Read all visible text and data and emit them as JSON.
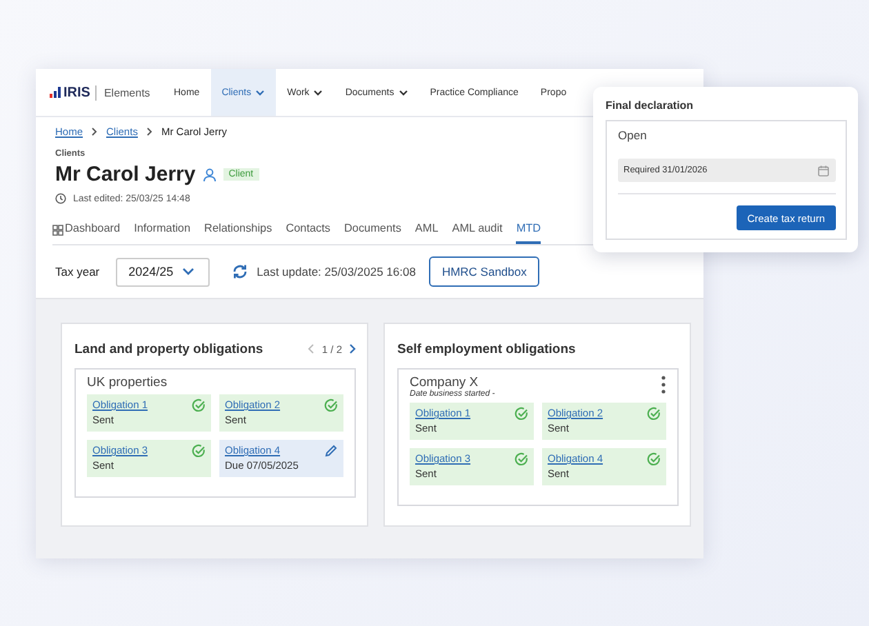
{
  "nav": {
    "logo": "IRIS",
    "product": "Elements",
    "items": [
      {
        "label": "Home",
        "selected": false,
        "dropdown": false
      },
      {
        "label": "Clients",
        "selected": true,
        "dropdown": true
      },
      {
        "label": "Work",
        "selected": false,
        "dropdown": true
      },
      {
        "label": "Documents",
        "selected": false,
        "dropdown": true
      },
      {
        "label": "Practice Compliance",
        "selected": false,
        "dropdown": false
      },
      {
        "label": "Propo",
        "selected": false,
        "dropdown": false
      }
    ]
  },
  "breadcrumb": [
    {
      "label": "Home",
      "link": true
    },
    {
      "label": "Clients",
      "link": true
    },
    {
      "label": "Mr Carol Jerry",
      "link": false
    }
  ],
  "client": {
    "section": "Clients",
    "name": "Mr Carol Jerry",
    "badge": "Client",
    "last_edited": "Last edited: 25/03/25 14:48"
  },
  "tabs": [
    {
      "label": "Dashboard",
      "selected": false
    },
    {
      "label": "Information",
      "selected": false
    },
    {
      "label": "Relationships",
      "selected": false
    },
    {
      "label": "Contacts",
      "selected": false
    },
    {
      "label": "Documents",
      "selected": false
    },
    {
      "label": "AML",
      "selected": false
    },
    {
      "label": "AML audit",
      "selected": false
    },
    {
      "label": "MTD",
      "selected": true
    }
  ],
  "toolbar": {
    "tax_year_label": "Tax year",
    "tax_year": "2024/25",
    "last_update": "Last update: 25/03/2025 16:08",
    "sandbox_button": "HMRC Sandbox"
  },
  "panels": [
    {
      "title": "Land and property obligations",
      "pager": "1 / 2",
      "group": {
        "name": "UK properties",
        "obligations": [
          {
            "label": "Obligation 1",
            "status": "Sent",
            "kind": "sent"
          },
          {
            "label": "Obligation 2",
            "status": "Sent",
            "kind": "sent"
          },
          {
            "label": "Obligation 3",
            "status": "Sent",
            "kind": "sent"
          },
          {
            "label": "Obligation 4",
            "status": "Due 07/05/2025",
            "kind": "due"
          }
        ]
      }
    },
    {
      "title": "Self employment obligations",
      "group": {
        "name": "Company X",
        "subtitle": "Date business started -",
        "menu": true,
        "obligations": [
          {
            "label": "Obligation 1",
            "status": "Sent",
            "kind": "sent"
          },
          {
            "label": "Obligation 2",
            "status": "Sent",
            "kind": "sent"
          },
          {
            "label": "Obligation 3",
            "status": "Sent",
            "kind": "sent"
          },
          {
            "label": "Obligation 4",
            "status": "Sent",
            "kind": "sent"
          }
        ]
      }
    }
  ],
  "final_declaration": {
    "title": "Final declaration",
    "status": "Open",
    "required": "Required 31/01/2026",
    "button": "Create tax return"
  }
}
